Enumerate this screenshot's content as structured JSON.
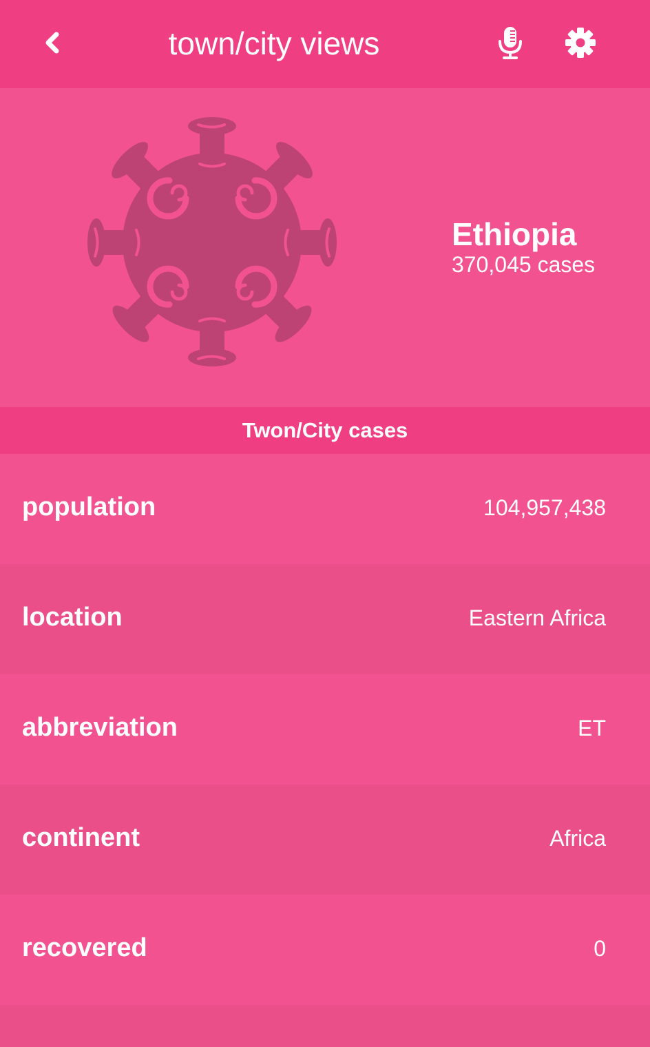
{
  "appbar": {
    "title": "town/city views",
    "back_icon": "chevron-left-icon",
    "mic_icon": "microphone-icon",
    "settings_icon": "gear-icon"
  },
  "hero": {
    "illustration": "virus-icon",
    "country": "Ethiopia",
    "cases": "370,045 cases"
  },
  "section": {
    "header": "Twon/City cases"
  },
  "details": [
    {
      "label": "population",
      "value": "104,957,438"
    },
    {
      "label": "location",
      "value": "Eastern Africa"
    },
    {
      "label": "abbreviation",
      "value": "ET"
    },
    {
      "label": "continent",
      "value": "Africa"
    },
    {
      "label": "recovered",
      "value": "0"
    }
  ],
  "colors": {
    "appbar": "#f03e83",
    "hero_background": "#f25290",
    "row_alternate": "#ea4f89",
    "virus": "#bc4373",
    "text": "#ffffff"
  }
}
